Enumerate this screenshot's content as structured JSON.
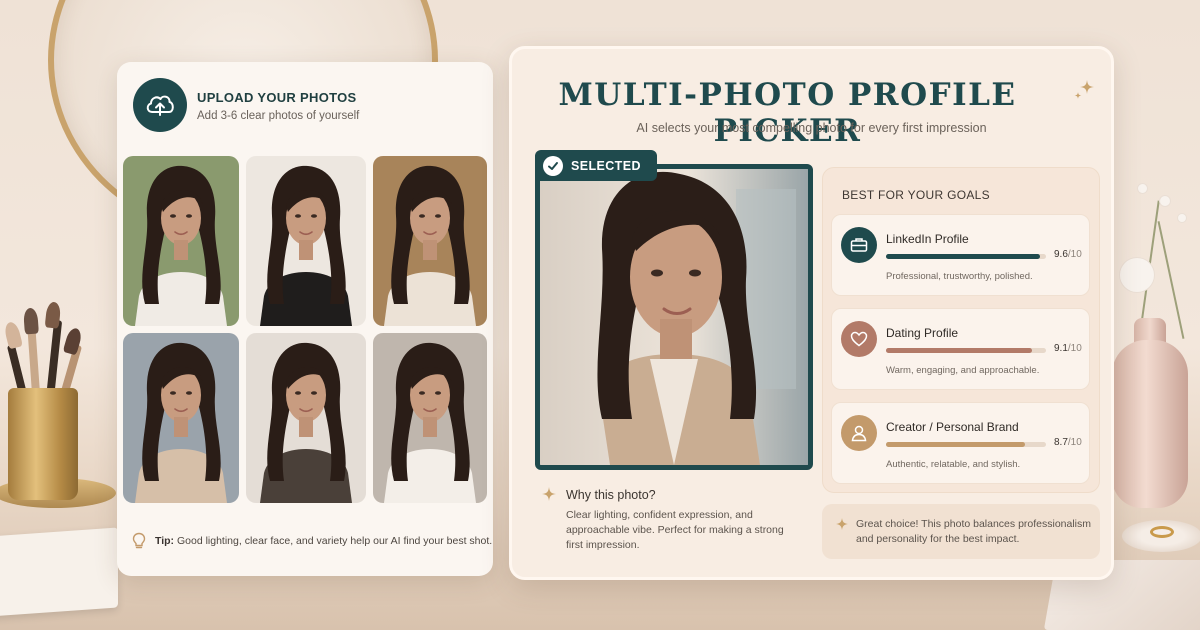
{
  "upload": {
    "title": "UPLOAD YOUR PHOTOS",
    "subtitle": "Add 3-6 clear photos of yourself",
    "photos": [
      {
        "top": "#f0ebe5",
        "bg": "#8a9a6e"
      },
      {
        "top": "#1f1d1c",
        "bg": "#ede7e0"
      },
      {
        "top": "#ece2d6",
        "bg": "#a8845a"
      },
      {
        "top": "#d6bfa8",
        "bg": "#9aa3ab"
      },
      {
        "top": "#4a4039",
        "bg": "#e4ddd6"
      },
      {
        "top": "#f3eee8",
        "bg": "#bfb6ad"
      }
    ],
    "tip_label": "Tip:",
    "tip_text": "Good lighting, clear face, and variety help our AI find your best shot."
  },
  "main": {
    "title": "MULTI-PHOTO PROFILE PICKER",
    "subtitle": "AI selects your most compelling photo for every first impression",
    "selected_label": "SELECTED",
    "why_title": "Why this photo?",
    "why_text": "Clear lighting, confident expression, and approachable vibe. Perfect for making a strong first impression."
  },
  "goals": {
    "title": "BEST FOR YOUR GOALS",
    "items": [
      {
        "name": "LinkedIn Profile",
        "score": "9.6",
        "denom": "/10",
        "desc": "Professional, trustworthy, polished.",
        "color": "#1f4a4d",
        "fraction": 0.96
      },
      {
        "name": "Dating Profile",
        "score": "9.1",
        "denom": "/10",
        "desc": "Warm, engaging, and approachable.",
        "color": "#b27a68",
        "fraction": 0.91
      },
      {
        "name": "Creator / Personal Brand",
        "score": "8.7",
        "denom": "/10",
        "desc": "Authentic, relatable, and stylish.",
        "color": "#c39a6b",
        "fraction": 0.87
      }
    ]
  },
  "note": {
    "text": "Great choice! This photo balances professionalism and personality for the best impact."
  },
  "colors": {
    "teal": "#1f4a4d",
    "gold": "#c9a36c",
    "rose": "#b27a68",
    "tan": "#c39a6b"
  },
  "icons": {
    "upload": "cloud-upload-icon",
    "selected": "check-icon",
    "linkedin": "briefcase-icon",
    "dating": "heart-icon",
    "creator": "person-icon",
    "tip": "lightbulb-icon",
    "sparkle": "sparkle-icon"
  }
}
